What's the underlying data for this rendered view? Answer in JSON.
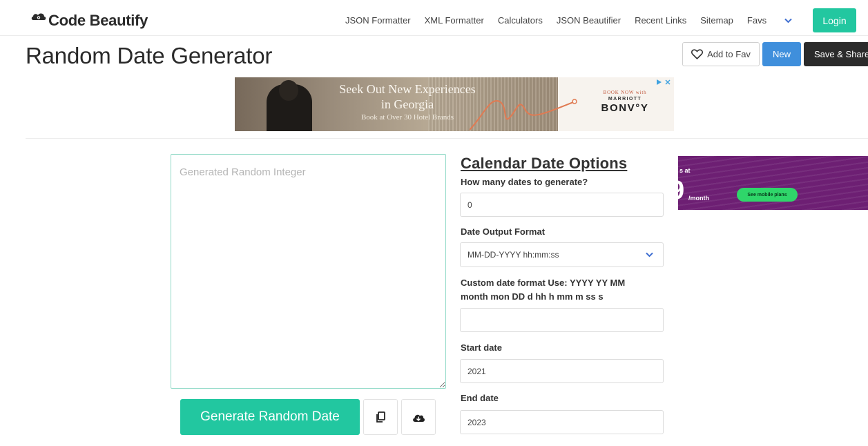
{
  "brand": {
    "name": "Code Beautify",
    "logo_icon": "cloud-eye-icon"
  },
  "nav": {
    "links": [
      "JSON Formatter",
      "XML Formatter",
      "Calculators",
      "JSON Beautifier",
      "Recent Links",
      "Sitemap"
    ],
    "favs_label": "Favs",
    "login_label": "Login"
  },
  "page": {
    "title": "Random Date Generator"
  },
  "toolbar": {
    "add_fav_label": "Add to Fav",
    "new_label": "New",
    "save_share_label": "Save & Share"
  },
  "ad_top": {
    "headline_line1": "Seek Out New Experiences",
    "headline_line2": "in Georgia",
    "subline": "Book at Over 30 Hotel Brands",
    "book_now": "BOOK NOW with",
    "marriott": "MARRIOTT",
    "bonvoy": "BONV°Y"
  },
  "output": {
    "placeholder": "Generated Random Integer"
  },
  "actions": {
    "generate_label": "Generate Random Date"
  },
  "options": {
    "title": "Calendar Date Options",
    "count_label": "How many dates to generate?",
    "count_value": "0",
    "format_label": "Date Output Format",
    "format_selected": "MM-DD-YYYY hh:mm:ss",
    "custom_label": "Custom date format Use: YYYY YY MM month mon DD d hh h mm m ss s",
    "custom_value": "",
    "start_label": "Start date",
    "start_value": "2021",
    "end_label": "End date",
    "end_value": "2023"
  },
  "ad_right": {
    "at_text": "s at",
    "big_text": "9",
    "month_text": "/month",
    "cta": "See mobile plans"
  },
  "colors": {
    "accent": "#22c7a0",
    "primary_blue": "#3f8fdc",
    "dark": "#2b2b2b",
    "ad_purple": "#6d1f73"
  }
}
